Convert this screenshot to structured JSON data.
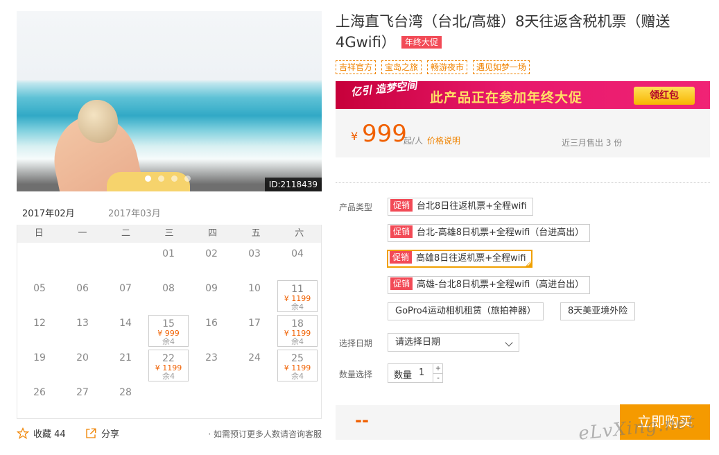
{
  "product": {
    "id_badge": "ID:2118439",
    "title": "上海直飞台湾（台北/高雄）8天往返含税机票（赠送4Gwifi）",
    "promo_tag": "年终大促",
    "tags": [
      "吉祥官方",
      "宝岛之旅",
      "畅游夜市",
      "遇见如梦一场"
    ]
  },
  "banner": {
    "logo": "亿引 造梦空间",
    "message": "此产品正在参加年终大促",
    "button": "领红包"
  },
  "price": {
    "currency": "¥",
    "amount": "999",
    "suffix": "起/人",
    "note_link": "价格说明",
    "sold": "近三月售出 3 份"
  },
  "calendar": {
    "tabs": [
      "2017年02月",
      "2017年03月"
    ],
    "active_tab": 0,
    "weekdays": [
      "日",
      "一",
      "二",
      "三",
      "四",
      "五",
      "六"
    ],
    "days": [
      {
        "day": "01",
        "col": 3,
        "row": 0
      },
      {
        "day": "02",
        "col": 4,
        "row": 0
      },
      {
        "day": "03",
        "col": 5,
        "row": 0
      },
      {
        "day": "04",
        "col": 6,
        "row": 0
      },
      {
        "day": "05",
        "col": 0,
        "row": 1
      },
      {
        "day": "06",
        "col": 1,
        "row": 1
      },
      {
        "day": "07",
        "col": 2,
        "row": 1
      },
      {
        "day": "08",
        "col": 3,
        "row": 1
      },
      {
        "day": "09",
        "col": 4,
        "row": 1
      },
      {
        "day": "10",
        "col": 5,
        "row": 1
      },
      {
        "day": "11",
        "col": 6,
        "row": 1,
        "price": "¥ 1199",
        "stock": "余4"
      },
      {
        "day": "12",
        "col": 0,
        "row": 2
      },
      {
        "day": "13",
        "col": 1,
        "row": 2
      },
      {
        "day": "14",
        "col": 2,
        "row": 2
      },
      {
        "day": "15",
        "col": 3,
        "row": 2,
        "price": "¥ 999",
        "stock": "余4"
      },
      {
        "day": "16",
        "col": 4,
        "row": 2
      },
      {
        "day": "17",
        "col": 5,
        "row": 2
      },
      {
        "day": "18",
        "col": 6,
        "row": 2,
        "price": "¥ 1199",
        "stock": "余4"
      },
      {
        "day": "19",
        "col": 0,
        "row": 3
      },
      {
        "day": "20",
        "col": 1,
        "row": 3
      },
      {
        "day": "21",
        "col": 2,
        "row": 3
      },
      {
        "day": "22",
        "col": 3,
        "row": 3,
        "price": "¥ 1199",
        "stock": "余4"
      },
      {
        "day": "23",
        "col": 4,
        "row": 3
      },
      {
        "day": "24",
        "col": 5,
        "row": 3
      },
      {
        "day": "25",
        "col": 6,
        "row": 3,
        "price": "¥ 1199",
        "stock": "余4"
      },
      {
        "day": "26",
        "col": 0,
        "row": 4
      },
      {
        "day": "27",
        "col": 1,
        "row": 4
      },
      {
        "day": "28",
        "col": 2,
        "row": 4
      }
    ]
  },
  "actions": {
    "favorite": "收藏 44",
    "share": "分享",
    "note": "· 如需预订更多人数请咨询客服"
  },
  "form": {
    "type_label": "产品类型",
    "promo_badge": "促销",
    "options": [
      {
        "label": "台北8日往返机票+全程wifi",
        "promo": true,
        "selected": false
      },
      {
        "label": "台北-高雄8日机票+全程wifi（台进高出）",
        "promo": true,
        "selected": false
      },
      {
        "label": "高雄8日往返机票+全程wifi",
        "promo": true,
        "selected": true
      },
      {
        "label": "高雄-台北8日机票+全程wifi（高进台出）",
        "promo": true,
        "selected": false
      },
      {
        "label": "GoPro4运动相机租赁（旅拍神器）",
        "promo": false,
        "selected": false
      },
      {
        "label": "8天美亚境外险",
        "promo": false,
        "selected": false
      }
    ],
    "date_label": "选择日期",
    "date_placeholder": "请选择日期",
    "qty_label": "数量选择",
    "qty_inner_label": "数量",
    "qty_value": "1",
    "plus": "+",
    "minus": "-"
  },
  "buy": {
    "total": "--",
    "button": "立即购买"
  },
  "watermark": "eLvXing.net",
  "colors": {
    "accent": "#f08300",
    "price": "#f06000",
    "promo": "#f24a56",
    "buy": "#f59a00"
  }
}
